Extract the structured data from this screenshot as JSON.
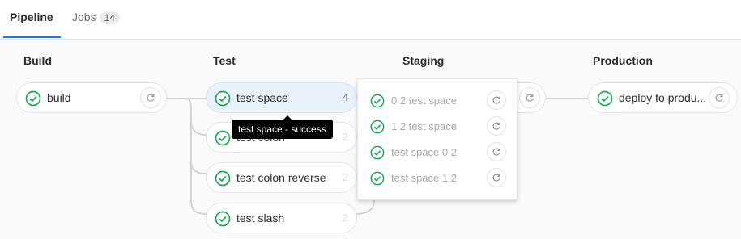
{
  "tabs": {
    "pipeline_label": "Pipeline",
    "jobs_label": "Jobs",
    "jobs_count": "14"
  },
  "stages": {
    "build": "Build",
    "test": "Test",
    "staging": "Staging",
    "production": "Production"
  },
  "jobs": {
    "build": "build",
    "test_space": "test space",
    "test_space_count": "4",
    "test_colon": "test colon",
    "test_colon_count": "2",
    "test_colon_reverse": "test colon reverse",
    "test_colon_reverse_count": "2",
    "test_slash": "test slash",
    "test_slash_count": "2",
    "deploy": "deploy to produ..."
  },
  "dropdown": {
    "items": [
      {
        "label": "0 2 test space"
      },
      {
        "label": "1 2 test space"
      },
      {
        "label": "test space 0 2"
      },
      {
        "label": "test space 1 2"
      }
    ]
  },
  "tooltip": {
    "text": "test space - success"
  },
  "colors": {
    "success": "#1aaa55",
    "accent": "#1f78d1"
  }
}
